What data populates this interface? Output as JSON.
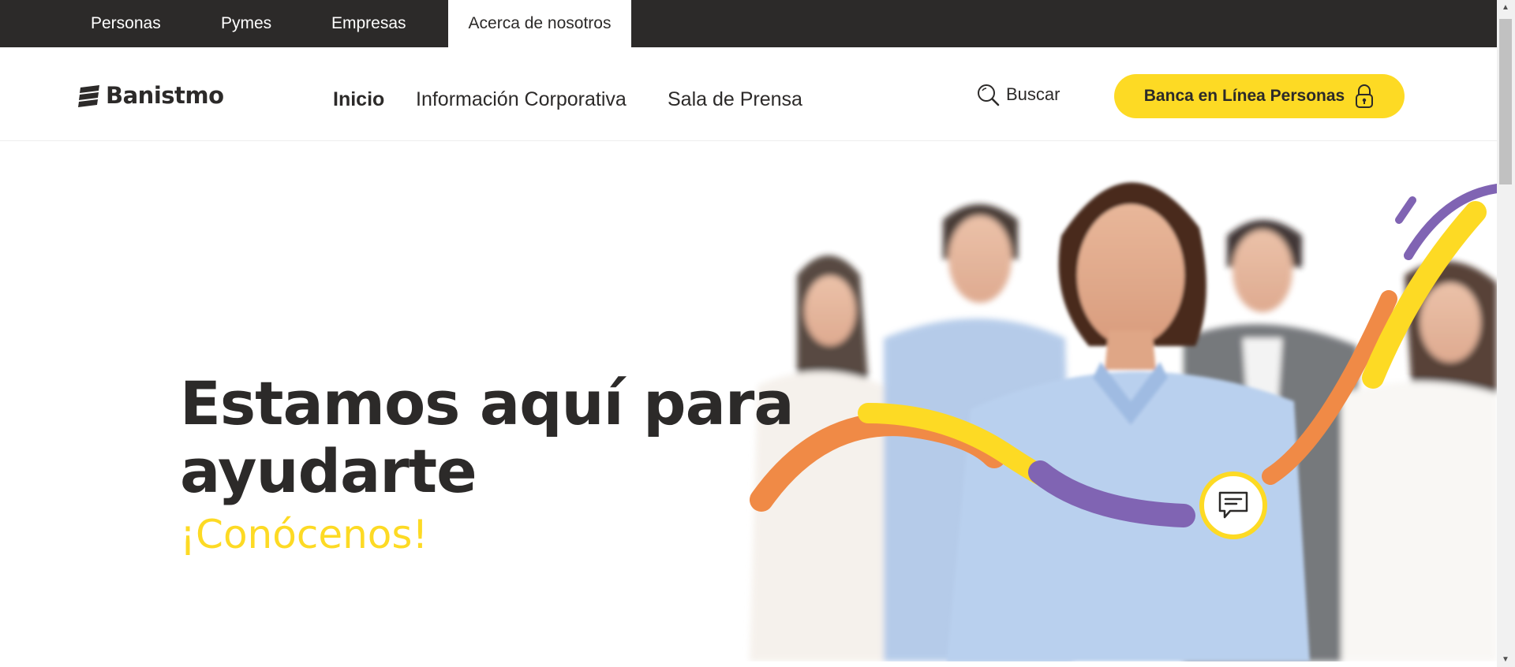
{
  "segments": [
    {
      "label": "Personas",
      "active": false
    },
    {
      "label": "Pymes",
      "active": false
    },
    {
      "label": "Empresas",
      "active": false
    },
    {
      "label": "Acerca de nosotros",
      "active": true
    }
  ],
  "brand": {
    "name": "Banistmo"
  },
  "nav": {
    "items": [
      {
        "label": "Inicio",
        "current": true
      },
      {
        "label": "Información Corporativa",
        "current": false
      },
      {
        "label": "Sala de Prensa",
        "current": false
      }
    ]
  },
  "search": {
    "label": "Buscar",
    "icon": "search-icon"
  },
  "online_banking": {
    "label": "Banca en Línea Personas",
    "icon": "lock-icon"
  },
  "hero": {
    "title_line1": "Estamos aquí para",
    "title_line2": "ayudarte",
    "subtitle": "¡Conócenos!",
    "chat_icon": "chat-icon"
  },
  "colors": {
    "brand_dark": "#2c2a29",
    "brand_yellow": "#fdda24",
    "accent_orange": "#f08a46",
    "accent_purple": "#8064b3"
  }
}
